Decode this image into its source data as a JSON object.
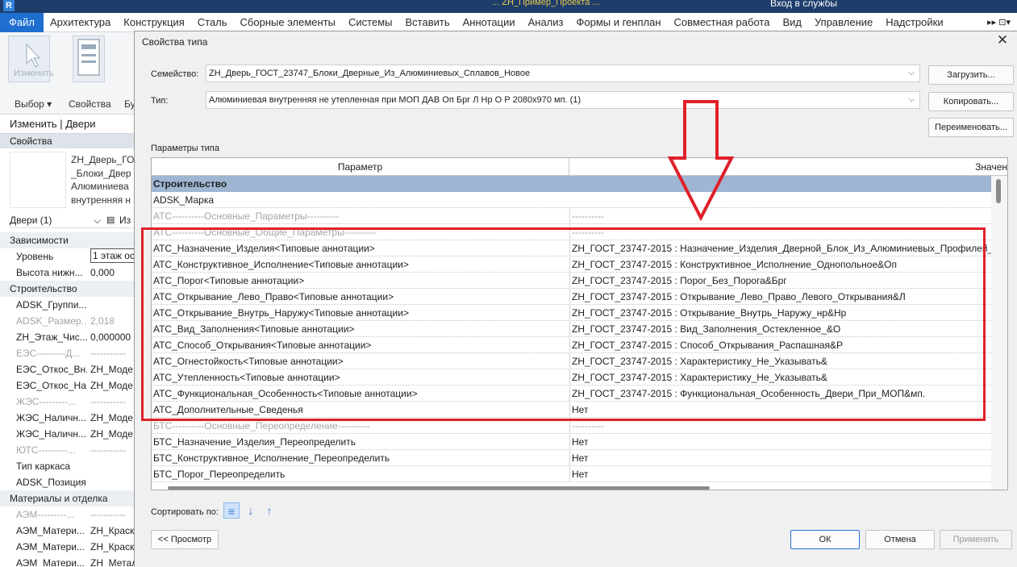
{
  "top_bar": {
    "logo": "R",
    "title_fragment": "... ZH_Пример_Проекта ...",
    "signin": "Вход в службы"
  },
  "menu": {
    "file": "Файл",
    "items": [
      "Архитектура",
      "Конструкция",
      "Сталь",
      "Сборные элементы",
      "Системы",
      "Вставить",
      "Аннотации",
      "Анализ",
      "Формы и генплан",
      "Совместная работа",
      "Вид",
      "Управление",
      "Надстройки"
    ],
    "more": "▸▸ ⊡▾"
  },
  "ribbon": {
    "modify_label": "Изменить",
    "select_label": "Выбор ▾",
    "properties_label": "Свойства",
    "extra_label": "Бу"
  },
  "context_bar": "Изменить | Двери",
  "properties": {
    "header": "Свойства",
    "type_name_lines": [
      "ZH_Дверь_ГО",
      "_Блоки_Двер",
      "Алюминиева",
      "внутренняя н"
    ],
    "selector": "Двери (1)",
    "edit_type": "Из",
    "rows": [
      {
        "kind": "grp",
        "name": "Зависимости",
        "value": ""
      },
      {
        "kind": "row",
        "name": "Уровень",
        "value": "1 этаж ос"
      },
      {
        "kind": "row",
        "name": "Высота нижн...",
        "value": "0,000"
      },
      {
        "kind": "grp",
        "name": "Строительство",
        "value": ""
      },
      {
        "kind": "row",
        "name": "ADSK_Группи...",
        "value": ""
      },
      {
        "kind": "gray",
        "name": "ADSK_Размер...",
        "value": "2,018"
      },
      {
        "kind": "row",
        "name": "ZH_Этаж_Чис...",
        "value": "0,000000"
      },
      {
        "kind": "gray",
        "name": "ЕЭС---------Д...",
        "value": "-----------"
      },
      {
        "kind": "row",
        "name": "ЕЭС_Откос_Вн...",
        "value": "ZH_Моде"
      },
      {
        "kind": "row",
        "name": "ЕЭС_Откос_На...",
        "value": "ZH_Моде"
      },
      {
        "kind": "gray",
        "name": "ЖЭС---------...",
        "value": "-----------"
      },
      {
        "kind": "row",
        "name": "ЖЭС_Наличн...",
        "value": "ZH_Моде"
      },
      {
        "kind": "row",
        "name": "ЖЭС_Наличн...",
        "value": "ZH_Моде"
      },
      {
        "kind": "gray",
        "name": "ЮТС---------...",
        "value": "-----------"
      },
      {
        "kind": "row",
        "name": "Тип каркаса",
        "value": ""
      },
      {
        "kind": "row",
        "name": "ADSK_Позиция",
        "value": ""
      },
      {
        "kind": "grp",
        "name": "Материалы и отделка",
        "value": ""
      },
      {
        "kind": "gray",
        "name": "АЭМ---------...",
        "value": "-----------"
      },
      {
        "kind": "row",
        "name": "АЭМ_Матери...",
        "value": "ZH_Краск"
      },
      {
        "kind": "row",
        "name": "АЭМ_Матери...",
        "value": "ZH_Краск"
      },
      {
        "kind": "row",
        "name": "АЭМ_Матери...",
        "value": "ZH_Металл..."
      }
    ]
  },
  "dialog": {
    "title": "Свойства типа",
    "family_label": "Семейство:",
    "family_value": "ZH_Дверь_ГОСТ_23747_Блоки_Дверные_Из_Алюминиевых_Сплавов_Новое",
    "type_label": "Тип:",
    "type_value": "Алюминиевая внутренняя не утепленная при МОП ДАВ Оп Брг Л Нр О Р 2080х970 мп. (1)",
    "load_button": "Загрузить...",
    "copy_button": "Копировать...",
    "rename_button": "Переименовать...",
    "params_label": "Параметры типа",
    "col_param": "Параметр",
    "col_value": "Значен",
    "sort_label": "Сортировать по:",
    "preview_button": "<< Просмотр",
    "ok_button": "ОК",
    "cancel_button": "Отмена",
    "apply_button": "Применить"
  },
  "table_rows": [
    {
      "kind": "cat",
      "param": "Строительство",
      "value": ""
    },
    {
      "kind": "edit",
      "param": "ADSK_Марка",
      "value": ""
    },
    {
      "kind": "dim",
      "param": "АТС----------Основные_Параметры----------",
      "value": "----------"
    },
    {
      "kind": "dim",
      "param": "АТС----------Основные_Общие_Параметры----------",
      "value": "----------"
    },
    {
      "kind": "row",
      "param": "АТС_Назначение_Изделия<Типовые аннотации>",
      "value": "ZH_ГОСТ_23747-2015 : Назначение_Изделия_Дверной_Блок_Из_Алюминиевых_Профилей_"
    },
    {
      "kind": "row",
      "param": "АТС_Конструктивное_Исполнение<Типовые аннотации>",
      "value": "ZH_ГОСТ_23747-2015 : Конструктивное_Исполнение_Однопольное&Оп"
    },
    {
      "kind": "row",
      "param": "АТС_Порог<Типовые аннотации>",
      "value": "ZH_ГОСТ_23747-2015 : Порог_Без_Порога&Брг"
    },
    {
      "kind": "row",
      "param": "АТС_Открывание_Лево_Право<Типовые аннотации>",
      "value": "ZH_ГОСТ_23747-2015 : Открывание_Лево_Право_Левого_Открывания&Л"
    },
    {
      "kind": "row",
      "param": "АТС_Открывание_Внутрь_Наружу<Типовые аннотации>",
      "value": "ZH_ГОСТ_23747-2015 : Открывание_Внутрь_Наружу_нр&Нр"
    },
    {
      "kind": "row",
      "param": "АТС_Вид_Заполнения<Типовые аннотации>",
      "value": "ZH_ГОСТ_23747-2015 : Вид_Заполнения_Остекленное_&О"
    },
    {
      "kind": "row",
      "param": "АТС_Способ_Открывания<Типовые аннотации>",
      "value": "ZH_ГОСТ_23747-2015 : Способ_Открывания_Распашная&Р"
    },
    {
      "kind": "row",
      "param": "АТС_Огнестойкость<Типовые аннотации>",
      "value": "ZH_ГОСТ_23747-2015 : Характеристику_Не_Указывать&"
    },
    {
      "kind": "row",
      "param": "АТС_Утепленность<Типовые аннотации>",
      "value": "ZH_ГОСТ_23747-2015 : Характеристику_Не_Указывать&"
    },
    {
      "kind": "row",
      "param": "АТС_Функциональная_Особенность<Типовые аннотации>",
      "value": "ZH_ГОСТ_23747-2015 : Функциональная_Особенность_Двери_При_МОП&мп."
    },
    {
      "kind": "row",
      "param": "АТС_Дополнительные_Сведенья",
      "value": "Нет"
    },
    {
      "kind": "dim",
      "param": "БТС----------Основные_Переопределение----------",
      "value": "----------"
    },
    {
      "kind": "row",
      "param": "БТС_Назначение_Изделия_Переопределить",
      "value": "Нет"
    },
    {
      "kind": "row",
      "param": "БТС_Конструктивное_Исполнение_Переопределить",
      "value": "Нет"
    },
    {
      "kind": "row",
      "param": "БТС_Порог_Переопределить",
      "value": "Нет"
    }
  ],
  "colors": {
    "accent_blue": "#1f6fd1",
    "category_row": "#9fb6d2",
    "highlight_red": "#e0202a"
  }
}
